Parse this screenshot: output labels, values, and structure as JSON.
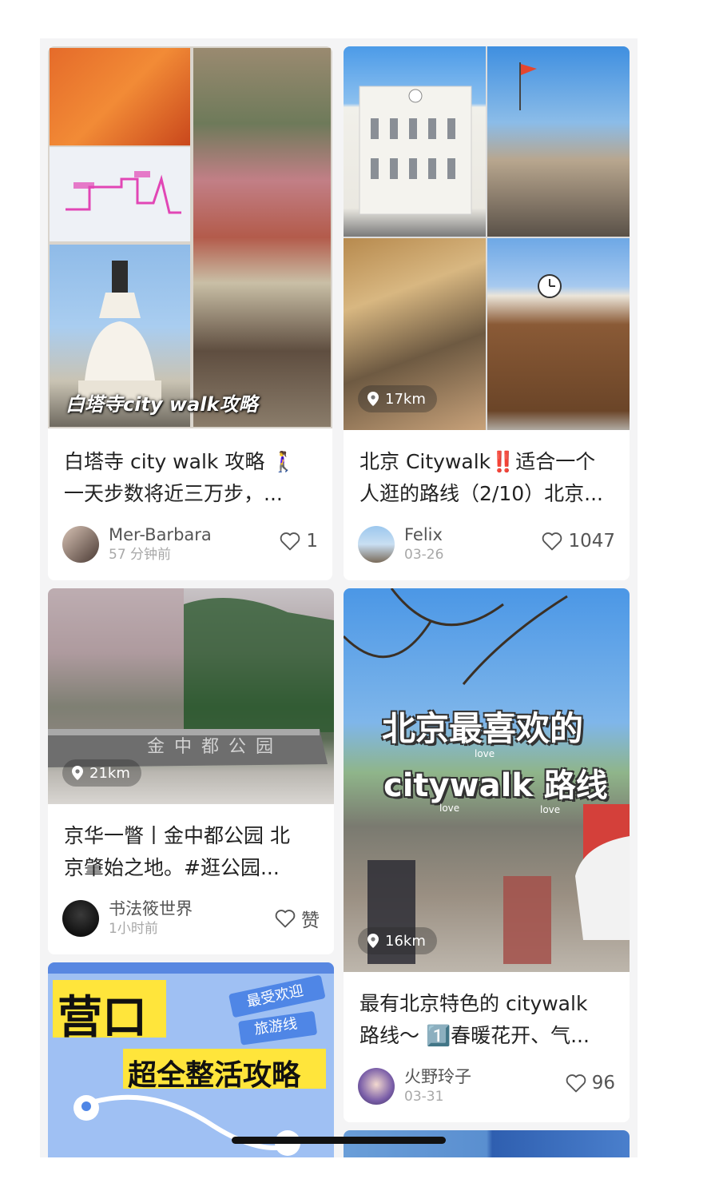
{
  "cards": [
    {
      "cover_overlay_text": "白塔寺city walk攻略",
      "title_line1": "白塔寺 city walk 攻略 🚶‍♀️",
      "title_line2": "一天步数将近三万步，...",
      "author": "Mer-Barbara",
      "time": "57 分钟前",
      "likes": "1"
    },
    {
      "distance": "17km",
      "title_line1": "北京 Citywalk‼️适合一个",
      "title_line2": "人逛的路线（2/10）北京...",
      "author": "Felix",
      "time": "03-26",
      "likes": "1047"
    },
    {
      "distance": "21km",
      "cover_sign_text": "金中都公园",
      "title_line1": "京华一瞥丨金中都公园 北",
      "title_line2": "京肇始之地。#逛公园...",
      "author": "书法筱世界",
      "time": "1小时前",
      "likes": "赞"
    },
    {
      "distance": "16km",
      "cover_headline1": "北京最喜欢的",
      "cover_headline2": "citywalk 路线",
      "cover_love": "love",
      "title_line1": "最有北京特色的 citywalk",
      "title_line2": "路线～ 1️⃣春暖花开、气...",
      "author": "火野玲子",
      "time": "03-31",
      "likes": "96"
    },
    {
      "cover_headline1": "营口",
      "cover_headline2": "超全整活攻略",
      "cover_tag1": "最受欢迎",
      "cover_tag2": "旅游线"
    }
  ],
  "colors": {
    "accent_red": "#e8323c",
    "sky_blue": "#5aa3e6",
    "poster_yellow": "#ffe53b",
    "poster_blue": "#9fc0f3"
  },
  "icons": [
    "heart-icon",
    "location-pin-icon",
    "avatar"
  ]
}
